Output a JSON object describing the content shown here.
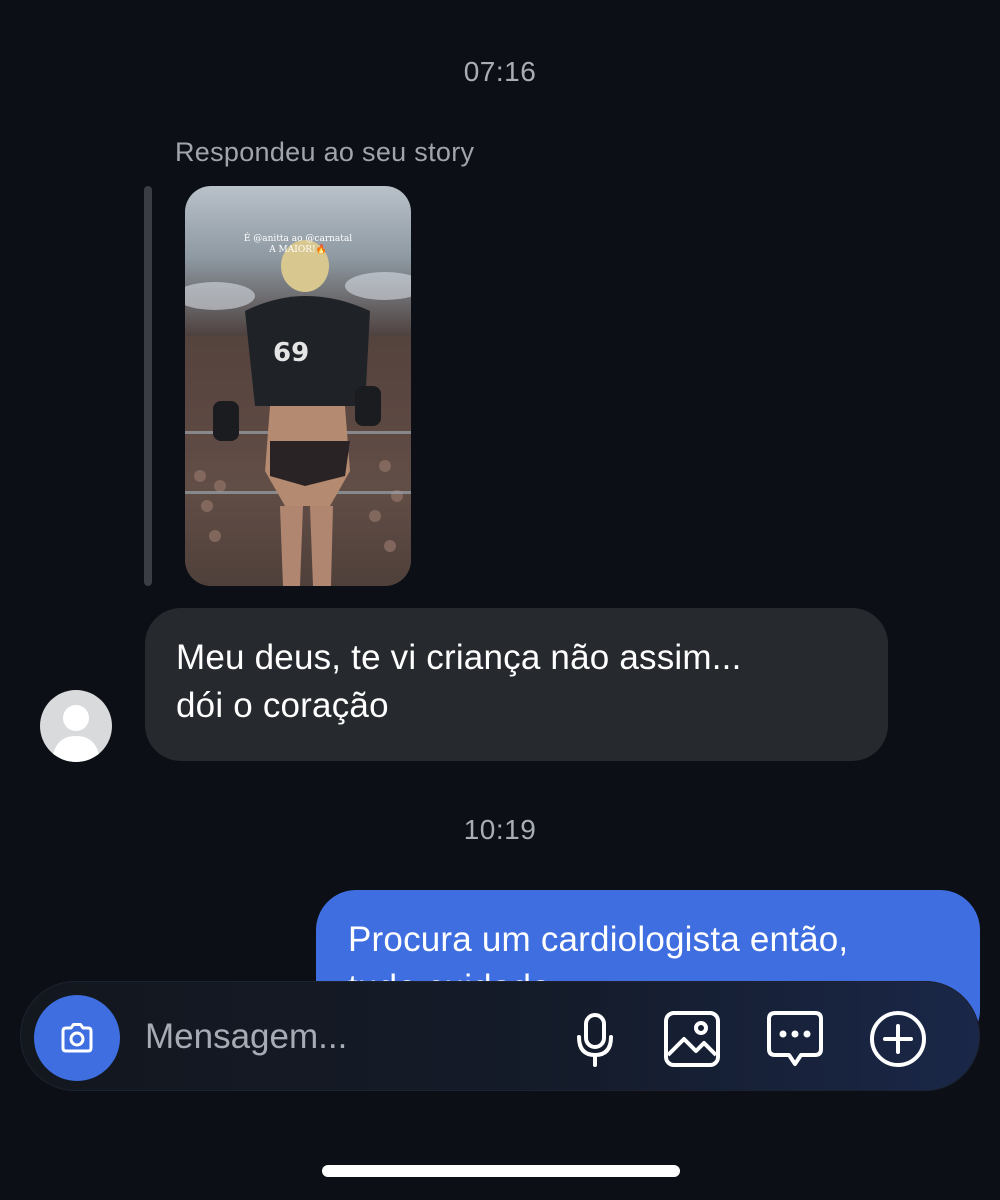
{
  "conversation": {
    "timestamp_1": "07:16",
    "reply_note": "Respondeu ao seu story",
    "story": {
      "caption_line1": "É @anitta ao @carnatal",
      "caption_line2": "A MAIOR!🔥"
    },
    "incoming_message": {
      "line1": "Meu deus,  te vi criança não assim...",
      "line2": "dói o coração"
    },
    "timestamp_2": "10:19",
    "outgoing_message": {
      "line1": "Procura um cardiologista então,",
      "line2": "tudo cuidado"
    }
  },
  "composer": {
    "placeholder": "Mensagem...",
    "icons": [
      "camera-icon",
      "microphone-icon",
      "gallery-icon",
      "sticker-icon",
      "plus-icon"
    ]
  },
  "colors": {
    "background": "#0c1016",
    "incoming_bubble": "#262a2f",
    "outgoing_bubble": "#3f6ee0",
    "accent": "#3f6ee0"
  }
}
